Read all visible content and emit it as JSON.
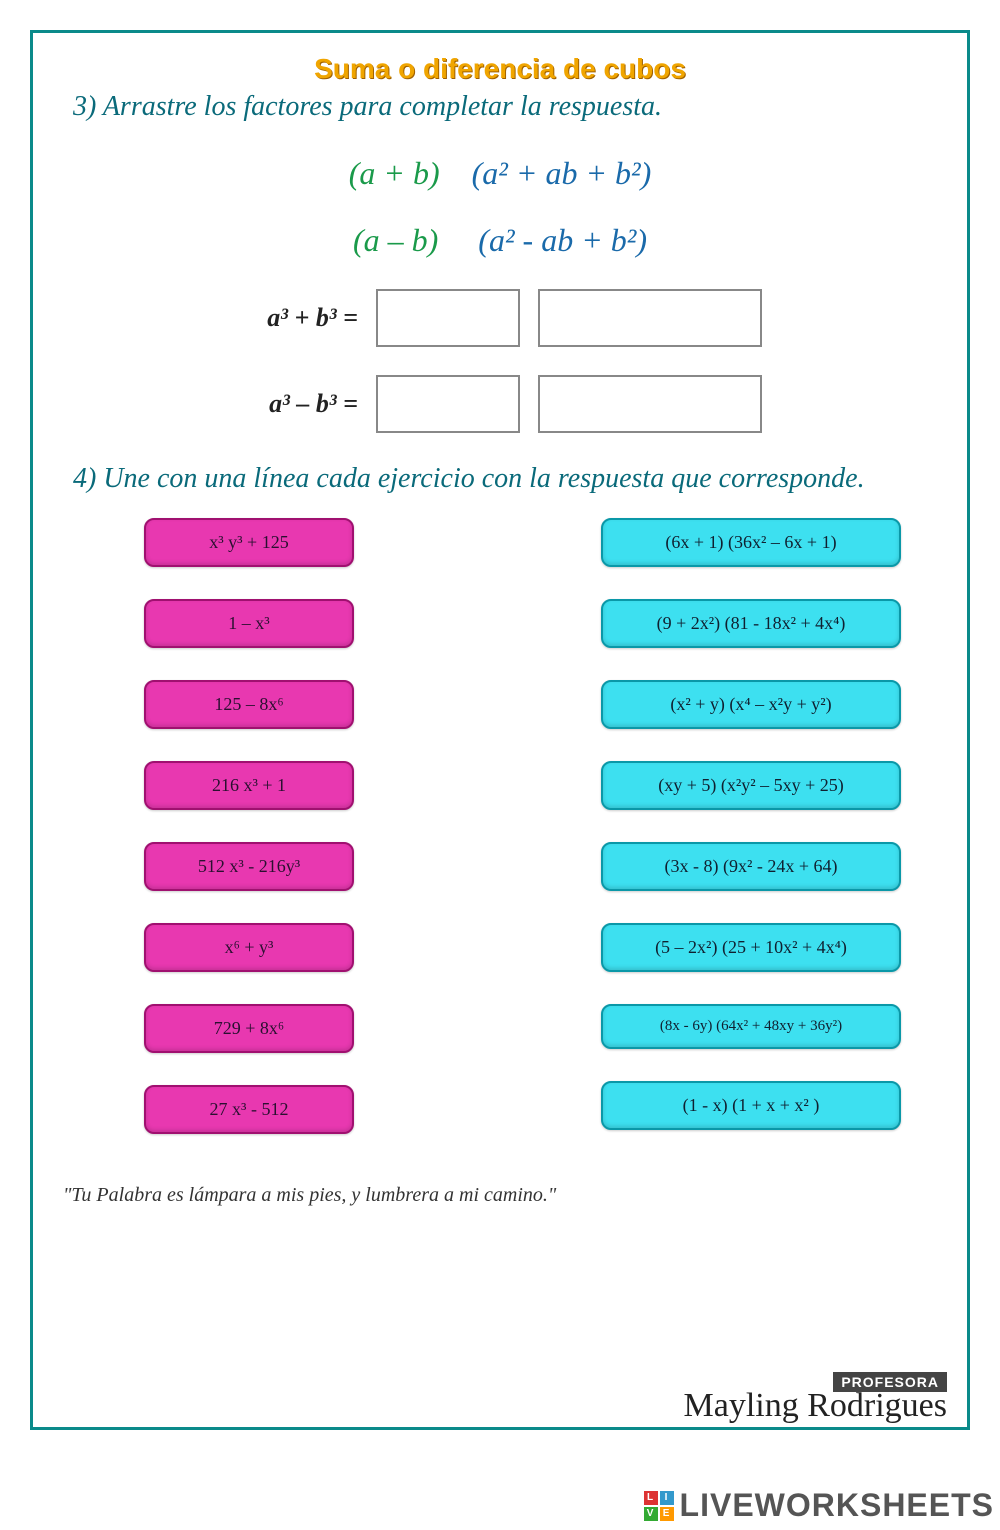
{
  "title": "Suma o diferencia de cubos",
  "q3": {
    "instruction": "3) Arrastre los factores para completar la respuesta.",
    "drag_factor1": "(a + b)",
    "drag_expand1": "(a² + ab + b²)",
    "drag_factor2": "(a – b)",
    "drag_expand2": "(a² -  ab + b²)",
    "label_sum": "a³ + b³ =",
    "label_diff": "a³ – b³ ="
  },
  "q4": {
    "instruction": "4) Une con una línea cada ejercicio con la respuesta que corresponde.",
    "left": [
      "x³ y³ + 125",
      "1 – x³",
      "125 – 8x⁶",
      "216 x³ + 1",
      "512 x³ - 216y³",
      "x⁶  +  y³",
      "729 + 8x⁶",
      "27 x³ - 512"
    ],
    "right": [
      "(6x + 1) (36x² – 6x + 1)",
      "(9 + 2x²) (81 - 18x² + 4x⁴)",
      "(x² + y) (x⁴ – x²y + y²)",
      "(xy + 5) (x²y² – 5xy + 25)",
      "(3x - 8) (9x² - 24x + 64)",
      "(5 – 2x²) (25 + 10x² + 4x⁴)",
      "(8x - 6y) (64x² + 48xy + 36y²)",
      "(1 - x) (1 + x + x² )"
    ]
  },
  "footer_quote": "\"Tu Palabra es lámpara a mis pies, y lumbrera a mi camino.\"",
  "signature": {
    "badge": "PROFESORA",
    "name": "Mayling Rodrigues"
  },
  "watermark": "LIVEWORKSHEETS"
}
